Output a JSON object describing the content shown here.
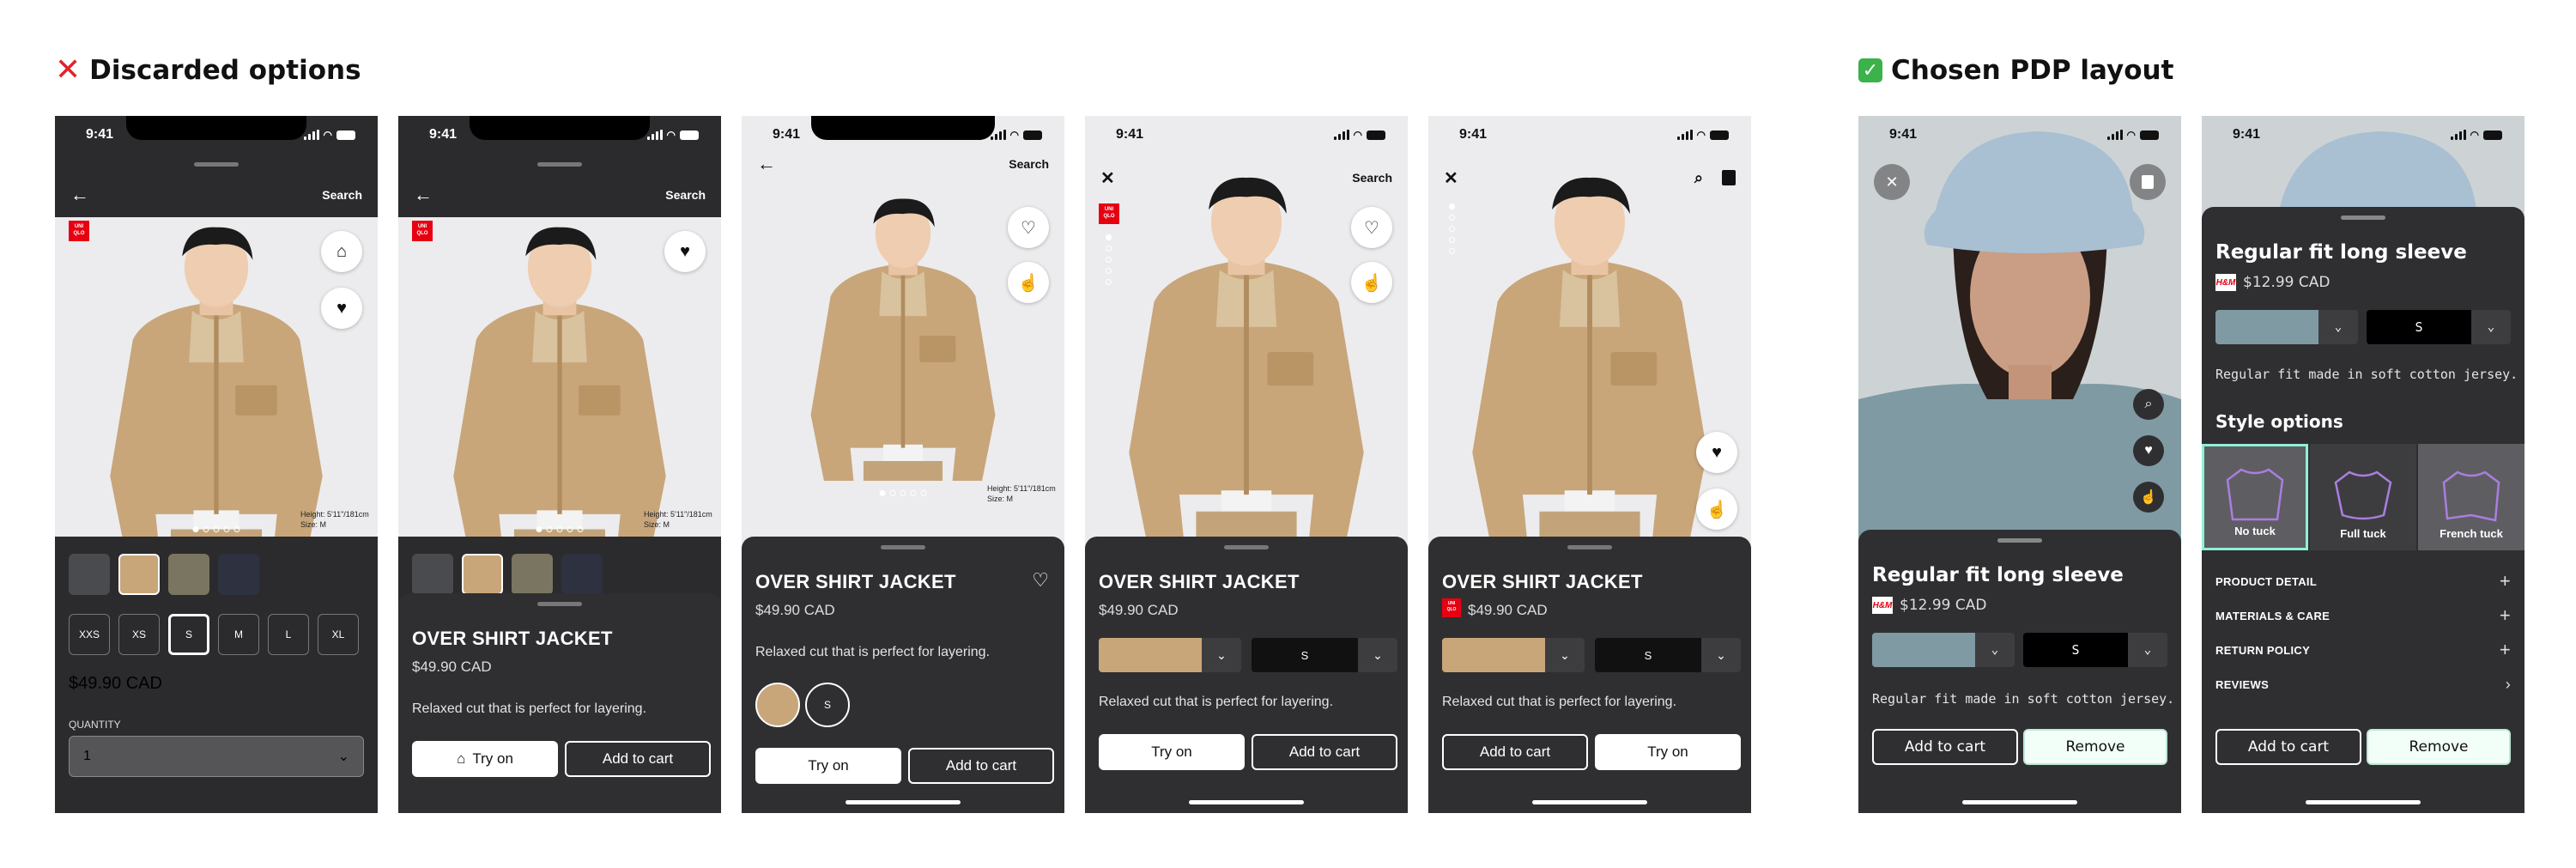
{
  "sections": {
    "discarded": "Discarded options",
    "chosen": "Chosen PDP layout"
  },
  "status_time": "9:41",
  "colors": {
    "khaki": "#c8a67a",
    "dark_bg": "#2f2f31",
    "brand_red": "#e60012",
    "steel_blue": "#7f9aa3",
    "mint_border": "#8ff0d8",
    "remove_bg": "#f2fff8",
    "lavender": "#a97ee0"
  },
  "icons": {
    "back": "arrow-left-icon",
    "close": "close-icon",
    "heart": "heart-icon",
    "hanger": "hanger-icon",
    "hand": "hand-pointer-icon",
    "search": "search-icon",
    "bag": "shopping-bag-icon",
    "chevron": "chevron-down-icon",
    "plus": "plus-icon",
    "chevron_right": "chevron-right-icon"
  },
  "brand": {
    "logo_line1": "UNI",
    "logo_line2": "QLO"
  },
  "jacket": {
    "name": "OVER SHIRT JACKET",
    "price": "$49.90 CAD",
    "desc": "Relaxed cut that is perfect for layering.",
    "height_label": "Height: 5'11\"/181cm",
    "size_label": "Size: M",
    "sizes": [
      "XXS",
      "XS",
      "S",
      "M",
      "L",
      "XL"
    ],
    "selected_size": "S",
    "quantity_label": "QUANTITY",
    "quantity_value": "1",
    "swatches": [
      "#4a4b4e",
      "#c8a67a",
      "#7a7560",
      "#2e3140"
    ]
  },
  "nav": {
    "search": "Search"
  },
  "buttons": {
    "try_on": "Try on",
    "add_to_cart": "Add to cart",
    "add_to_cart_alt": "Add to cart",
    "remove": "Remove"
  },
  "hm": {
    "name": "Regular fit long sleeve",
    "price": "$12.99 CAD",
    "desc": "Regular fit made in soft cotton jersey.",
    "size": "S",
    "logo": "H&M",
    "style_options_title": "Style options",
    "style_options": [
      "No tuck",
      "Full tuck",
      "French tuck"
    ],
    "accordion": [
      "PRODUCT DETAIL",
      "MATERIALS & CARE",
      "RETURN POLICY",
      "REVIEWS"
    ]
  }
}
